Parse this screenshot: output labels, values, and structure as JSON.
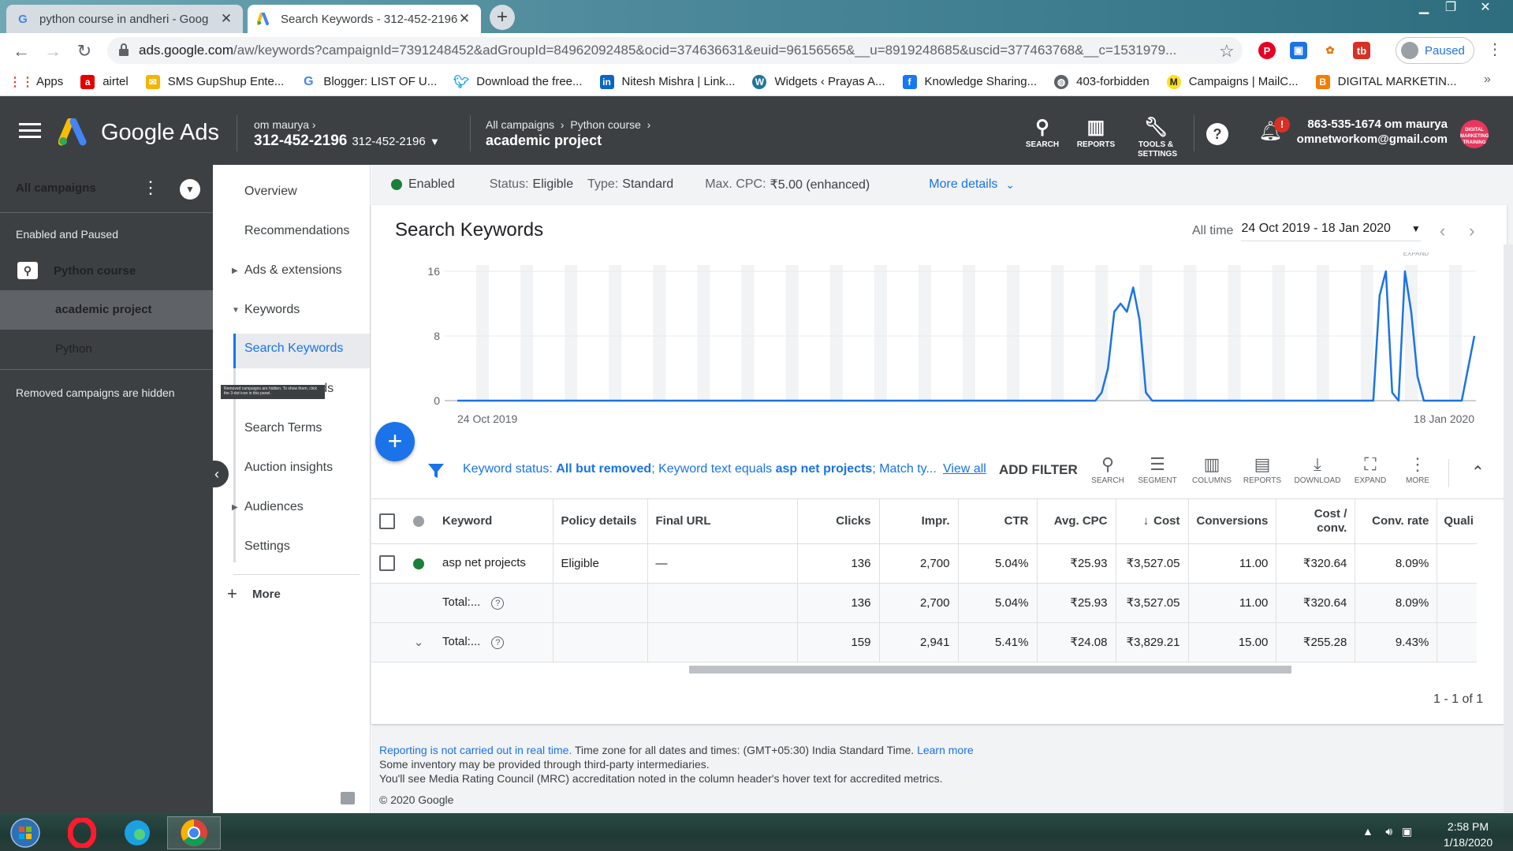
{
  "browser": {
    "tabs": [
      {
        "title": "python course in andheri - Goog",
        "favicon": "google-g"
      },
      {
        "title": "Search Keywords - 312-452-2196",
        "favicon": "google-ads"
      }
    ],
    "url_host": "ads.google.com",
    "url_rest": "/aw/keywords?campaignId=7391248452&adGroupId=84962092485&ocid=374636631&euid=96156565&__u=8919248685&uscid=377463768&__c=1531979...",
    "profile_status": "Paused",
    "bookmarks": [
      {
        "label": "Apps",
        "color": "#ea4335"
      },
      {
        "label": "airtel",
        "color": "#e40000"
      },
      {
        "label": "SMS GupShup Ente...",
        "color": "#f4b400"
      },
      {
        "label": "Blogger: LIST OF U...",
        "color": "#4285f4"
      },
      {
        "label": "Download the free...",
        "color": "#1da1f2"
      },
      {
        "label": "Nitesh Mishra | Link...",
        "color": "#0a66c2"
      },
      {
        "label": "Widgets ‹ Prayas A...",
        "color": "#21759b"
      },
      {
        "label": "Knowledge Sharing...",
        "color": "#1877f2"
      },
      {
        "label": "403-forbidden",
        "color": "#5f6368"
      },
      {
        "label": "Campaigns | MailC...",
        "color": "#ffe01b"
      },
      {
        "label": "DIGITAL MARKETIN...",
        "color": "#f57d00"
      }
    ]
  },
  "header": {
    "product": "Google Ads",
    "account_name": "om maurya",
    "account_id": "312-452-2196",
    "account_id_small": "312-452-2196",
    "breadcrumb": [
      "All campaigns",
      "Python course"
    ],
    "breadcrumb_title": "academic project",
    "icons": [
      {
        "label": "SEARCH",
        "icon": "search-icon"
      },
      {
        "label": "REPORTS",
        "icon": "reports-icon"
      },
      {
        "label": "TOOLS & SETTINGS",
        "icon": "wrench-icon"
      }
    ],
    "notification_badge": "!",
    "account_phone_name": "863-535-1674 om maurya",
    "account_email": "omnetworkom@gmail.com",
    "avatar_text": "DIGITAL MARKETING TRAINING"
  },
  "left_panel": {
    "all_campaigns": "All campaigns",
    "section": "Enabled and Paused",
    "campaign": "Python course",
    "ad_groups": [
      "academic project",
      "Python"
    ],
    "footer_note": "Removed campaigns are hidden"
  },
  "page_menu": {
    "items": [
      "Overview",
      "Recommendations",
      "Ads & extensions",
      "Keywords",
      "Search Keywords",
      "Negative Keywords",
      "Search Terms",
      "Auction insights",
      "Audiences",
      "Settings"
    ],
    "more": "More",
    "tooltip": "Removed campaigns are hidden. To show them, click the 3-dot icon in this panel.",
    "partial_visible": "vords"
  },
  "status_bar": {
    "enabled": "Enabled",
    "status_label": "Status:",
    "status_value": "Eligible",
    "type_label": "Type:",
    "type_value": "Standard",
    "cpc_label": "Max. CPC:",
    "cpc_value": "₹5.00 (enhanced)",
    "more_details": "More details"
  },
  "page_title": "Search Keywords",
  "date": {
    "label": "All time",
    "range": "24 Oct 2019 - 18 Jan 2020"
  },
  "chart_data": {
    "type": "line",
    "y_ticks": [
      0,
      8,
      16
    ],
    "ylim": [
      0,
      16
    ],
    "x_start_label": "24 Oct 2019",
    "x_end_label": "18 Jan 2020",
    "expand_label": "EXPAND",
    "series": [
      {
        "color": "#1a73e8",
        "values": [
          0,
          0,
          0,
          0,
          0,
          0,
          0,
          0,
          0,
          0,
          0,
          0,
          0,
          0,
          0,
          0,
          0,
          0,
          0,
          0,
          0,
          0,
          0,
          0,
          0,
          0,
          0,
          0,
          0,
          0,
          0,
          0,
          0,
          0,
          0,
          0,
          0,
          0,
          0,
          0,
          0,
          0,
          0,
          0,
          0,
          0,
          0,
          0,
          0,
          0,
          0,
          0,
          0,
          0,
          0,
          0,
          0,
          0,
          0,
          0,
          0,
          0,
          0,
          0,
          0,
          0,
          0,
          0,
          0,
          0,
          0,
          0,
          0,
          0,
          0,
          0,
          0,
          0,
          0,
          0,
          0,
          0,
          0,
          0,
          0,
          0,
          0,
          0,
          0,
          0,
          0,
          0,
          0,
          0,
          0,
          0,
          0,
          0,
          0,
          0,
          0,
          0,
          1,
          4,
          11,
          12,
          11,
          14,
          10,
          1,
          0,
          0,
          0,
          0,
          0,
          0,
          0,
          0,
          0,
          0,
          0,
          0,
          0,
          0,
          0,
          0,
          0,
          0,
          0,
          0,
          0,
          0,
          0,
          0,
          0,
          0,
          0,
          0,
          0,
          0,
          0,
          0,
          0,
          0,
          0,
          0,
          13,
          16,
          1,
          0,
          16,
          11,
          3,
          0,
          0,
          0,
          0,
          0,
          0,
          0,
          4,
          8
        ]
      }
    ]
  },
  "filters": {
    "parts": [
      {
        "label": "Keyword status: ",
        "value": "All but removed"
      },
      {
        "label": "; Keyword text equals ",
        "value": "asp net projects"
      },
      {
        "label": "; Match ty...",
        "value": ""
      }
    ],
    "view_all": "View all",
    "add_filter": "ADD FILTER"
  },
  "table_toolbar": [
    "SEARCH",
    "SEGMENT",
    "COLUMNS",
    "REPORTS",
    "DOWNLOAD",
    "EXPAND",
    "MORE"
  ],
  "table": {
    "columns": [
      "Keyword",
      "Policy details",
      "Final URL",
      "Clicks",
      "Impr.",
      "CTR",
      "Avg. CPC",
      "Cost",
      "Conversions",
      "Cost / conv.",
      "Conv. rate",
      "Quali"
    ],
    "rows": [
      {
        "keyword": "asp net projects",
        "policy": "Eligible",
        "url": "—",
        "clicks": "136",
        "impr": "2,700",
        "ctr": "5.04%",
        "cpc": "₹25.93",
        "cost": "₹3,527.05",
        "conv": "11.00",
        "cpconv": "₹320.64",
        "crate": "8.09%"
      }
    ],
    "totals": [
      {
        "label": "Total:...",
        "clicks": "136",
        "impr": "2,700",
        "ctr": "5.04%",
        "cpc": "₹25.93",
        "cost": "₹3,527.05",
        "conv": "11.00",
        "cpconv": "₹320.64",
        "crate": "8.09%"
      },
      {
        "label": "Total:...",
        "clicks": "159",
        "impr": "2,941",
        "ctr": "5.41%",
        "cpc": "₹24.08",
        "cost": "₹3,829.21",
        "conv": "15.00",
        "cpconv": "₹255.28",
        "crate": "9.43%"
      }
    ],
    "pager": "1 - 1 of 1"
  },
  "footer": {
    "line1_link": "Reporting is not carried out in real time.",
    "line1_text": " Time zone for all dates and times: (GMT+05:30) India Standard Time. ",
    "line1_learn": "Learn more",
    "line2": "Some inventory may be provided through third-party intermediaries.",
    "line3": "You'll see Media Rating Council (MRC) accreditation noted in the column header's hover text for accredited metrics.",
    "copyright": "© 2020 Google"
  },
  "taskbar": {
    "time": "2:58 PM",
    "date": "1/18/2020"
  }
}
